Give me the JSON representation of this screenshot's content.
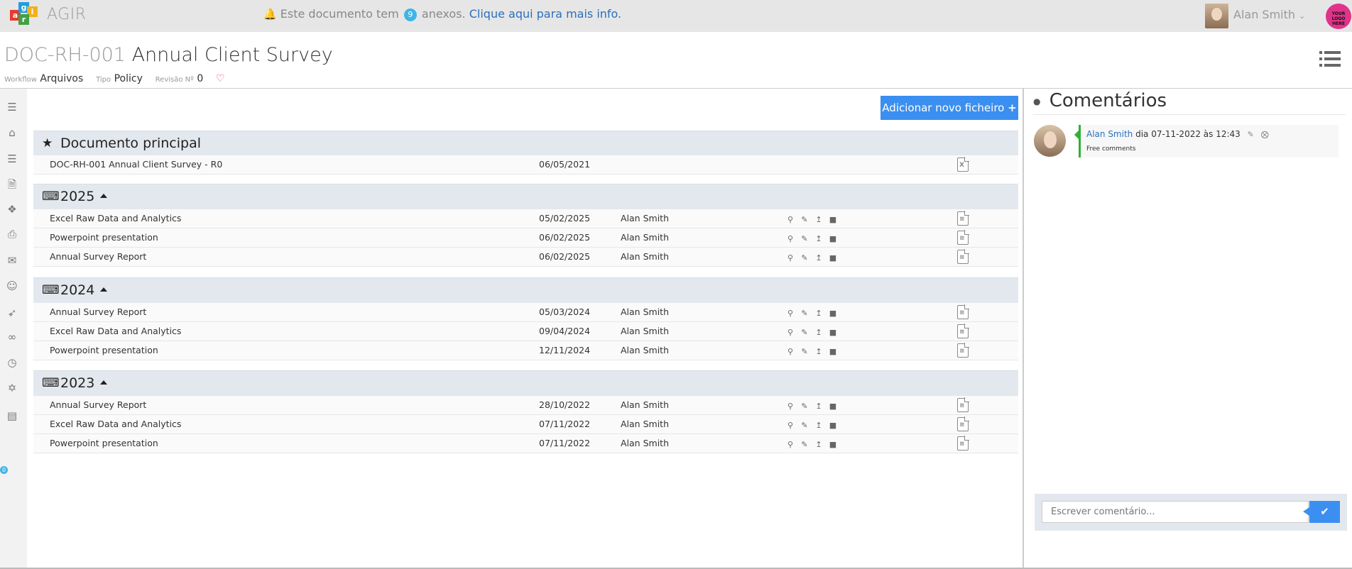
{
  "app": {
    "name": "AGIR",
    "logo_letters": [
      "a",
      "g",
      "i",
      "r"
    ],
    "brand_logo_text": "YOUR LOGO HERE"
  },
  "notice": {
    "prefix": "Este documento tem",
    "count": "9",
    "middle": "anexos.",
    "link": "Clique aqui para mais info."
  },
  "user": {
    "name": "Alan Smith"
  },
  "document": {
    "code": "DOC-RH-001",
    "title": "Annual Client Survey",
    "workflow_label": "Workflow",
    "workflow_value": "Arquivos",
    "type_label": "Tipo",
    "type_value": "Policy",
    "revision_label": "Revisão Nº",
    "revision_value": "0"
  },
  "sidebar": {
    "icons": [
      "menu-icon",
      "home-icon",
      "list-icon",
      "document-icon",
      "tags-icon",
      "print-icon",
      "envelope-icon",
      "users-icon",
      "paperclip-icon",
      "link-icon",
      "clock-icon",
      "accessibility-icon",
      "archive-icon"
    ],
    "badge": "0"
  },
  "main": {
    "add_button": "Adicionar novo ficheiro",
    "principal": {
      "title": "Documento principal",
      "file": {
        "name": "DOC-RH-001 Annual Client Survey - R0",
        "date": "06/05/2021"
      }
    },
    "sections": [
      {
        "year": "2025",
        "rows": [
          {
            "name": "Excel Raw Data and Analytics",
            "date": "05/02/2025",
            "author": "Alan Smith"
          },
          {
            "name": "Powerpoint presentation",
            "date": "06/02/2025",
            "author": "Alan Smith"
          },
          {
            "name": "Annual Survey Report",
            "date": "06/02/2025",
            "author": "Alan Smith"
          }
        ]
      },
      {
        "year": "2024",
        "rows": [
          {
            "name": "Annual Survey Report",
            "date": "05/03/2024",
            "author": "Alan Smith"
          },
          {
            "name": "Excel Raw Data and Analytics",
            "date": "09/04/2024",
            "author": "Alan Smith"
          },
          {
            "name": "Powerpoint presentation",
            "date": "12/11/2024",
            "author": "Alan Smith"
          }
        ]
      },
      {
        "year": "2023",
        "rows": [
          {
            "name": "Annual Survey Report",
            "date": "28/10/2022",
            "author": "Alan Smith"
          },
          {
            "name": "Excel Raw Data and Analytics",
            "date": "07/11/2022",
            "author": "Alan Smith"
          },
          {
            "name": "Powerpoint presentation",
            "date": "07/11/2022",
            "author": "Alan Smith"
          }
        ]
      }
    ]
  },
  "comments": {
    "title": "Comentários",
    "items": [
      {
        "author": "Alan Smith",
        "when": "dia 07-11-2022 às 12:43",
        "text": "Free comments"
      }
    ],
    "placeholder": "Escrever comentário..."
  }
}
